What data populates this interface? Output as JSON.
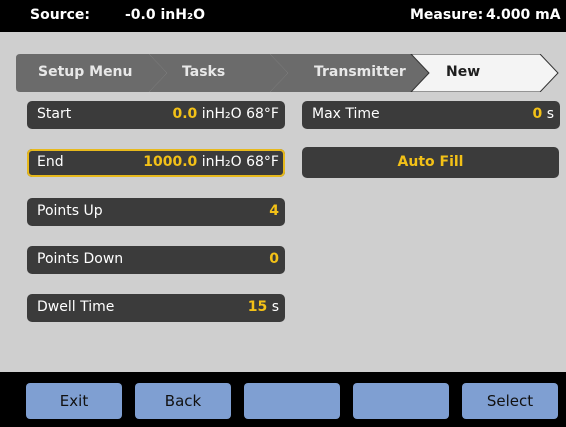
{
  "status": {
    "source_label": "Source:",
    "source_value": "-0.0 inH₂O",
    "measure_label": "Measure:",
    "measure_value": "4.000 mA"
  },
  "breadcrumb": {
    "items": [
      "Setup Menu",
      "Tasks",
      "Transmitter",
      "New"
    ],
    "active_index": 3
  },
  "fields": {
    "start": {
      "label": "Start",
      "value": "0.0",
      "unit": " inH₂O 68°F"
    },
    "end": {
      "label": "End",
      "value": "1000.0",
      "unit": " inH₂O 68°F"
    },
    "points_up": {
      "label": "Points Up",
      "value": "4",
      "unit": ""
    },
    "points_down": {
      "label": "Points Down",
      "value": "0",
      "unit": ""
    },
    "dwell_time": {
      "label": "Dwell Time",
      "value": "15",
      "unit": " s"
    },
    "max_time": {
      "label": "Max Time",
      "value": "0",
      "unit": " s"
    }
  },
  "auto_fill_label": "Auto Fill",
  "softkeys": [
    "Exit",
    "Back",
    "",
    "",
    "Select"
  ],
  "colors": {
    "accent": "#f3c117",
    "softkey": "#7f9fd2",
    "field_bg": "#3b3b3b"
  }
}
